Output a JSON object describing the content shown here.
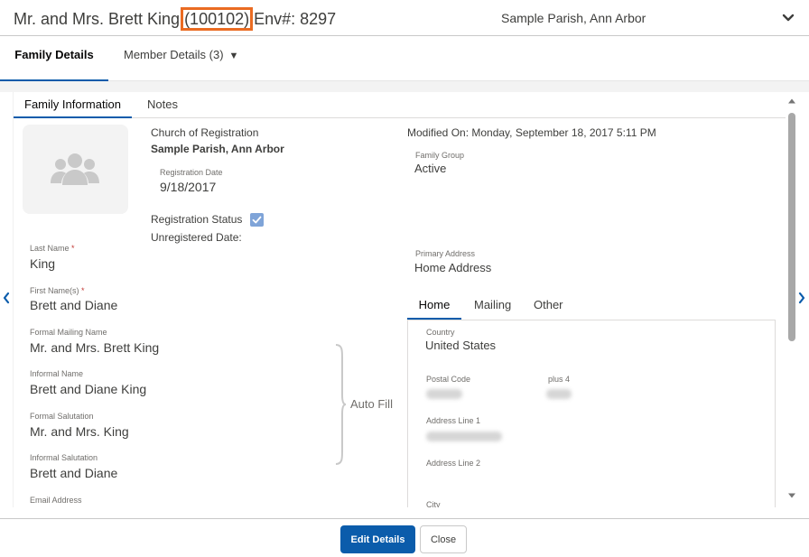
{
  "header": {
    "title_prefix": "Mr. and Mrs. Brett King",
    "family_id": "(100102)",
    "env_text": "Env#: 8297",
    "parish": "Sample Parish, Ann Arbor",
    "highlight_color": "#ea6b22"
  },
  "top_tabs": [
    {
      "label": "Family Details",
      "active": true
    },
    {
      "label": "Member Details (3)",
      "caret": "▼",
      "active": false
    }
  ],
  "inner_tabs": [
    {
      "label": "Family Information",
      "active": true
    },
    {
      "label": "Notes",
      "active": false
    }
  ],
  "registration": {
    "church_label": "Church of Registration",
    "church_value": "Sample Parish, Ann Arbor",
    "reg_date_label": "Registration Date",
    "reg_date_value": "9/18/2017",
    "status_label": "Registration Status",
    "status_checked": true,
    "unregistered_label": "Unregistered Date:"
  },
  "modified": {
    "text": "Modified On: Monday, September 18, 2017 5:11 PM"
  },
  "family_group": {
    "label": "Family Group",
    "value": "Active"
  },
  "primary_address": {
    "label": "Primary Address",
    "value": "Home Address"
  },
  "names": {
    "last_name_label": "Last Name",
    "last_name_value": "King",
    "first_names_label": "First Name(s)",
    "first_names_value": "Brett and Diane",
    "required_marker": "*",
    "formal_mailing_label": "Formal Mailing Name",
    "formal_mailing_value": "Mr. and Mrs. Brett King",
    "informal_name_label": "Informal Name",
    "informal_name_value": "Brett and Diane King",
    "formal_salutation_label": "Formal Salutation",
    "formal_salutation_value": "Mr. and Mrs. King",
    "informal_salutation_label": "Informal Salutation",
    "informal_salutation_value": "Brett and Diane",
    "email_label": "Email Address"
  },
  "auto_fill": "Auto Fill",
  "address_tabs": [
    {
      "label": "Home",
      "active": true
    },
    {
      "label": "Mailing",
      "active": false
    },
    {
      "label": "Other",
      "active": false
    }
  ],
  "address": {
    "country_label": "Country",
    "country_value": "United States",
    "postal_label": "Postal Code",
    "plus4_label": "plus 4",
    "line1_label": "Address Line 1",
    "line2_label": "Address Line 2",
    "city_label": "City"
  },
  "footer": {
    "edit_label": "Edit Details",
    "close_label": "Close",
    "primary_color": "#0b5cab"
  }
}
